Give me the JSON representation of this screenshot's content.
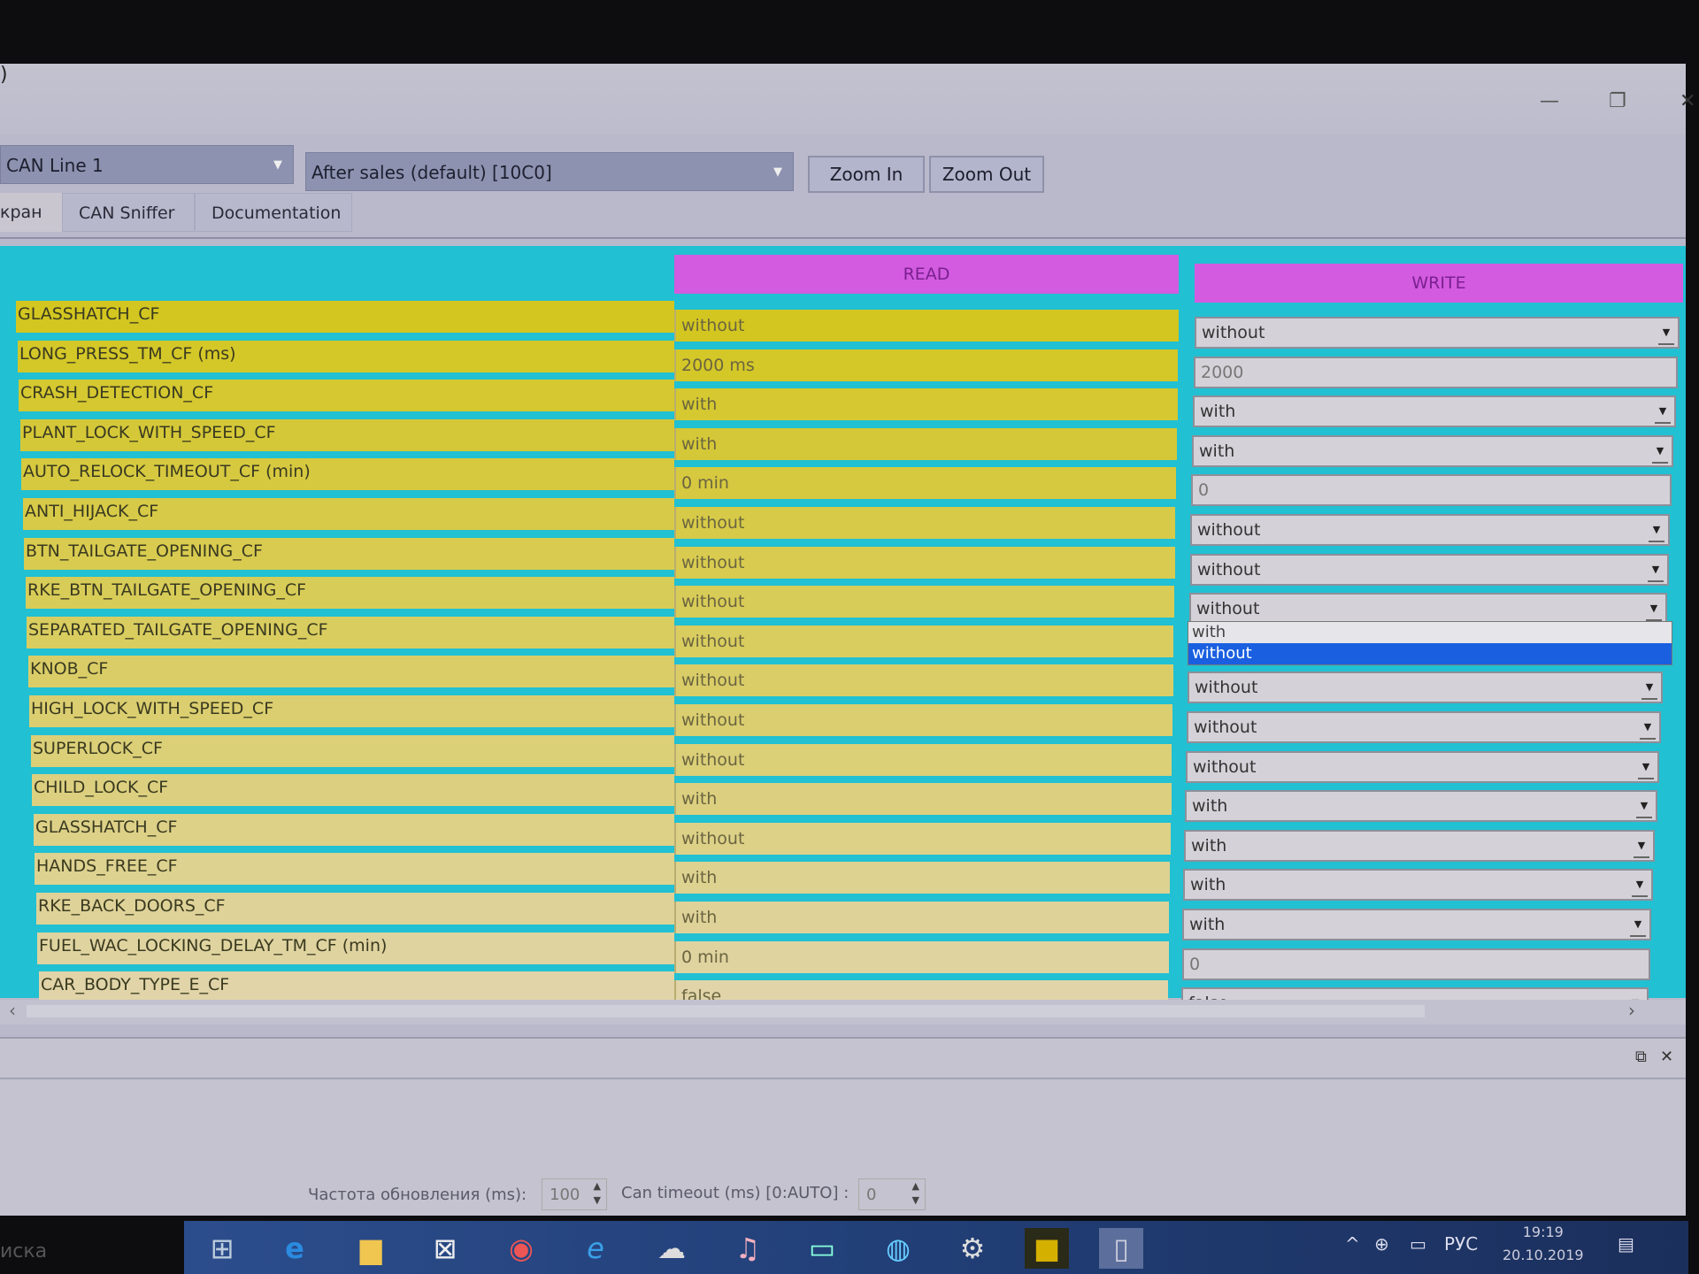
{
  "window": {
    "title_fragment": ")",
    "controls": {
      "minimize": "—",
      "maximize": "❐",
      "close": "✕"
    }
  },
  "toolbar": {
    "can_line_select": "CAN Line 1",
    "mode_select": "After sales (default) [10C0]",
    "zoom_in_label": "Zoom In",
    "zoom_out_label": "Zoom Out"
  },
  "tabs": [
    {
      "label": "кран",
      "active": true
    },
    {
      "label": "CAN Sniffer",
      "active": false
    },
    {
      "label": "Documentation",
      "active": false
    }
  ],
  "grid": {
    "read_header": "READ",
    "write_header": "WRITE",
    "colors": {
      "background": "#21c0d2",
      "header": "#d35be0",
      "row_top": "#d3c620",
      "row_bottom": "#e0d4a8"
    },
    "rows": [
      {
        "name": "GLASSHATCH_CF",
        "read": "without",
        "write": "without",
        "write_type": "dropdown"
      },
      {
        "name": "LONG_PRESS_TM_CF (ms)",
        "read": "2000 ms",
        "write": "2000",
        "write_type": "input"
      },
      {
        "name": "CRASH_DETECTION_CF",
        "read": "with",
        "write": "with",
        "write_type": "dropdown"
      },
      {
        "name": "PLANT_LOCK_WITH_SPEED_CF",
        "read": "with",
        "write": "with",
        "write_type": "dropdown"
      },
      {
        "name": "AUTO_RELOCK_TIMEOUT_CF (min)",
        "read": "0 min",
        "write": "0",
        "write_type": "input"
      },
      {
        "name": "ANTI_HIJACK_CF",
        "read": "without",
        "write": "without",
        "write_type": "dropdown"
      },
      {
        "name": "BTN_TAILGATE_OPENING_CF",
        "read": "without",
        "write": "without",
        "write_type": "dropdown"
      },
      {
        "name": "RKE_BTN_TAILGATE_OPENING_CF",
        "read": "without",
        "write": "without",
        "write_type": "dropdown"
      },
      {
        "name": "SEPARATED_TAILGATE_OPENING_CF",
        "read": "without",
        "write": "",
        "write_type": "none"
      },
      {
        "name": "KNOB_CF",
        "read": "without",
        "write": "without",
        "write_type": "dropdown"
      },
      {
        "name": "HIGH_LOCK_WITH_SPEED_CF",
        "read": "without",
        "write": "without",
        "write_type": "dropdown"
      },
      {
        "name": "SUPERLOCK_CF",
        "read": "without",
        "write": "without",
        "write_type": "dropdown"
      },
      {
        "name": "CHILD_LOCK_CF",
        "read": "with",
        "write": "with",
        "write_type": "dropdown"
      },
      {
        "name": "GLASSHATCH_CF",
        "read": "without",
        "write": "with",
        "write_type": "dropdown"
      },
      {
        "name": "HANDS_FREE_CF",
        "read": "with",
        "write": "with",
        "write_type": "dropdown"
      },
      {
        "name": "RKE_BACK_DOORS_CF",
        "read": "with",
        "write": "with",
        "write_type": "dropdown"
      },
      {
        "name": "FUEL_WAC_LOCKING_DELAY_TM_CF (min)",
        "read": "0 min",
        "write": "0",
        "write_type": "input"
      },
      {
        "name": "CAR_BODY_TYPE_E_CF",
        "read": "false",
        "write": "false",
        "write_type": "dropdown"
      }
    ],
    "open_dropdown": {
      "row_index": 7,
      "options": [
        "with",
        "without"
      ],
      "selected": "without",
      "highlight_color": "#1a5fe0"
    }
  },
  "lower_pane": {
    "pin_icon": "⧉",
    "close_icon": "✕"
  },
  "statusbar": {
    "refresh_label": "Частота обновления (ms):",
    "refresh_value": "100",
    "timeout_label": "Can timeout (ms) [0:AUTO] :",
    "timeout_value": "0"
  },
  "taskbar": {
    "left_text": "иска",
    "language": "РУС",
    "time": "19:19",
    "date": "20.10.2019"
  }
}
